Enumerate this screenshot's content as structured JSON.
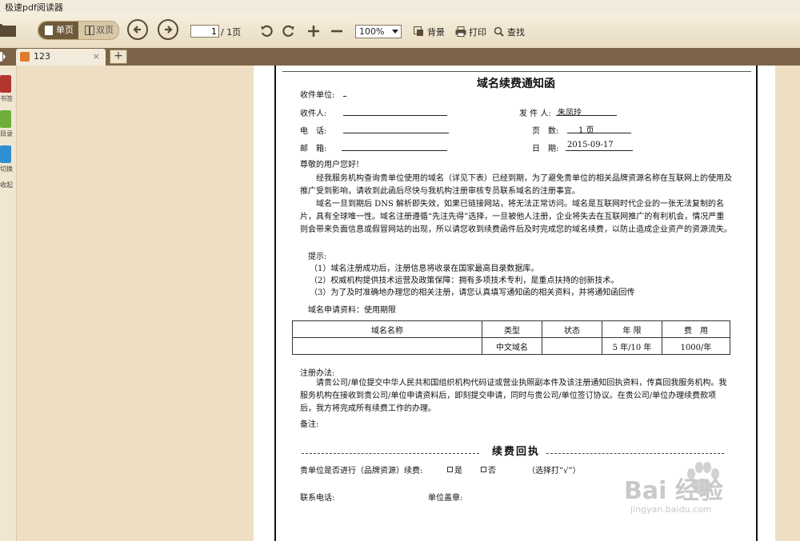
{
  "window": {
    "title": "极速pdf阅读器"
  },
  "toolbar": {
    "single_page": "单页",
    "double_page": "双页",
    "page_current": "1",
    "page_total": "/ 1页",
    "zoom": "100%",
    "background": "背景",
    "print": "打印",
    "find": "查找"
  },
  "tabs": [
    {
      "label": "123",
      "close": "×"
    }
  ],
  "new_tab": "+",
  "sidebar": {
    "items": [
      "书签",
      "目录",
      "切换",
      "收起"
    ]
  },
  "document": {
    "title": "域名续费通知函",
    "fields": {
      "recipient_unit_label": "收件单位:",
      "recipient_label": "收件人:",
      "sender_label": "发 件 人:",
      "sender_value": "朱凤玲",
      "phone_label": "电　话:",
      "pages_label": "页　数:",
      "pages_value": "1 页",
      "mail_label": "邮　箱:",
      "date_label": "日　期:",
      "date_value": "2015-09-17"
    },
    "greeting": "尊敬的用户您好!",
    "paragraph1": "经我服务机构查询贵单位使用的域名（详见下表）已经到期，为了避免贵单位的相关品牌资源名称在互联网上的使用及推广受到影响，请收到此函后尽快与我机构注册审核专员联系域名的注册事宜。",
    "paragraph2": "域名一旦到期后 DNS 解析即失效，如果已链接网站，将无法正常访问。域名是互联网时代企业的一张无法复制的名片，具有全球唯一性。域名注册遵循“先注先得”选择，一旦被他人注册，企业将失去在互联网推广的有利机会，情况严重则会带来负面信息或假冒网站的出现，所以请您收到续费函件后及时完成您的域名续费，以防止造成企业资产的资源流失。",
    "tips_label": "提示:",
    "tips": [
      "（1）域名注册成功后，注册信息将收录在国家最高目录数据库。",
      "（2）权威机构提供技术运营及政策保障：拥有多项技术专利，是重点扶持的创新技术。",
      "（3）为了及时准确地办理您的相关注册，请您认真填写通知函的相关资料，并将通知函回传"
    ],
    "apply_info": "域名申请资料：使用期限",
    "table": {
      "headers": [
        "域名名称",
        "类型",
        "状态",
        "年 限",
        "费　用"
      ],
      "rows": [
        [
          "",
          "中文域名",
          "",
          "5 年/10 年",
          "1000/年"
        ]
      ]
    },
    "register_label": "注册办法:",
    "register_text": "请贵公司/单位提交中华人民共和国组织机构代码证或营业执照副本件及该注册通知回执资料，传真回我服务机构。我服务机构在接收到贵公司/单位申请资料后，即刻提交申请，同时与贵公司/单位签订协议。在贵公司/单位办理续费款项后，我方将完成所有续费工作的办理。",
    "remark_label": "备注:",
    "receipt_title": "续费回执",
    "receipt_question": "贵单位是否进行（品牌资源）续费:",
    "opt_yes": "是",
    "opt_no": "否",
    "choose_hint": "（选择打“√”）",
    "contact_phone": "联系电话:",
    "unit_seal": "单位盖章:"
  },
  "watermark": {
    "brand": "Bai 经验",
    "url": "jingyan.baidu.com"
  },
  "colors": {
    "toolbar_bg": "#f1e8d4",
    "tabbar_bg": "#7b6447",
    "canvas_bg": "#eedfc4",
    "active_toggle": "#6f5a3a"
  }
}
